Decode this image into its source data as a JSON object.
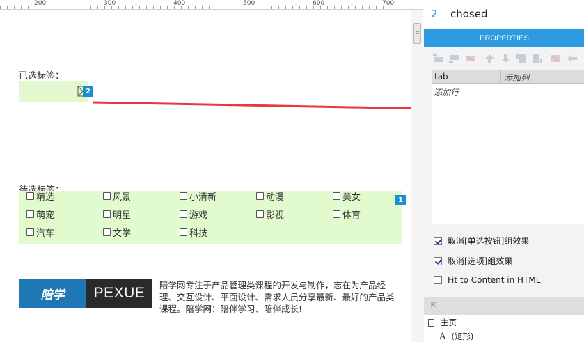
{
  "ruler": {
    "labels": [
      "200",
      "300",
      "400",
      "500",
      "600",
      "700"
    ]
  },
  "canvas": {
    "selected_label": "已选标签：",
    "selected_badge": "2",
    "candidate_label": "待选标签：",
    "candidate_badge": "1",
    "tags": [
      [
        "精选",
        "风景",
        "小清新",
        "动漫",
        "美女"
      ],
      [
        "萌宠",
        "明星",
        "游戏",
        "影视",
        "体育"
      ],
      [
        "汽车",
        "文学",
        "科技"
      ]
    ],
    "logo_left": "陪学",
    "logo_right": "PEXUE",
    "blurb": "陪学网专注于产品管理类课程的开发与制作，志在为产品经理、交互设计、平面设计、需求人员分享最新、最好的产品类课程。陪学网：陪伴学习、陪伴成长!"
  },
  "panel": {
    "number": "2",
    "name": "chosed",
    "tab": "PROPERTIES",
    "grid_col1": "tab",
    "grid_col2": "添加列",
    "grid_addrow": "添加行",
    "options": [
      {
        "label": "取消[单选按钮]组效果",
        "checked": true
      },
      {
        "label": "取消[选项]组效果",
        "checked": true
      },
      {
        "label": "Fit to Content in HTML",
        "checked": false
      }
    ],
    "outline_page": "主页",
    "outline_shape": "(矩形)",
    "outline_shape_icon": "A"
  },
  "colors": {
    "accent": "#2e9be0",
    "badge": "#1a8fd1",
    "arrow": "#e8383a",
    "panel_fill": "#e1fbcf"
  }
}
